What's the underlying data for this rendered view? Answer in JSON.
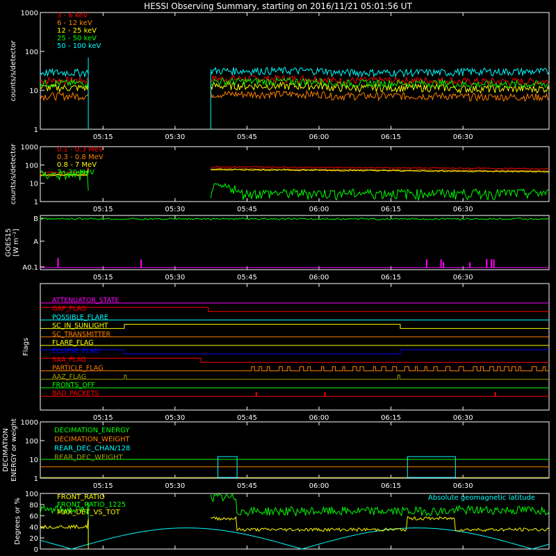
{
  "title": "HESSI Observing Summary, starting on 2016/11/21 05:01:56 UT",
  "time_ticks": [
    "05:15",
    "05:30",
    "05:45",
    "06:00",
    "06:15",
    "06:30"
  ],
  "colors": {
    "red": "#ff0000",
    "orange": "#ff8000",
    "yellow": "#ffff00",
    "green": "#00ff00",
    "cyan": "#00ffff",
    "magenta": "#ff00ff",
    "blue": "#0000ff",
    "olive": "#a0a000",
    "white": "#ffffff"
  },
  "chart_data": [
    {
      "id": "lightcurves-low",
      "type": "line",
      "ylabel": "counts/s/detector",
      "yscale": "log",
      "ylim": [
        1,
        1000
      ],
      "yticks": [
        "1",
        "10",
        "100",
        "1000"
      ],
      "series": [
        {
          "name": "3 - 6 keV",
          "color": "#ff0000",
          "level": 20
        },
        {
          "name": "6 - 12 keV",
          "color": "#ff8000",
          "level": 8
        },
        {
          "name": "12 - 25 keV",
          "color": "#ffff00",
          "level": 13
        },
        {
          "name": "25 - 50 keV",
          "color": "#00ff00",
          "level": 17
        },
        {
          "name": "50 - 100 keV",
          "color": "#00ffff",
          "level": 32
        }
      ]
    },
    {
      "id": "lightcurves-high",
      "type": "line",
      "ylabel": "counts/s/detector",
      "yscale": "log",
      "ylim": [
        1,
        1000
      ],
      "yticks": [
        "1",
        "10",
        "100",
        "1000"
      ],
      "series": [
        {
          "name": "0.1 - 0.3 MeV",
          "color": "#ff0000",
          "level": 80
        },
        {
          "name": "0.3 - 0.8 MeV",
          "color": "#ff8000",
          "level": 60
        },
        {
          "name": "0.8 - 7 MeV",
          "color": "#ffff00",
          "level": 55
        },
        {
          "name": "7 - 20 MeV",
          "color": "#00ff00",
          "level": 3
        }
      ]
    },
    {
      "id": "goes",
      "type": "line",
      "ylabel": "GOES15",
      "ylabel2": "[W m⁻²]",
      "yticks": [
        "A0.1",
        "A",
        "B"
      ]
    },
    {
      "id": "flags",
      "type": "line",
      "ylabel": "Flags",
      "flags": [
        {
          "name": "ATTENUATOR_STATE",
          "color": "#ff00ff"
        },
        {
          "name": "GAP_FLAG",
          "color": "#ff0000"
        },
        {
          "name": "POSSIBLE_FLARE",
          "color": "#00ffff"
        },
        {
          "name": "SC_IN_SUNLIGHT",
          "color": "#ffff00"
        },
        {
          "name": "SC_TRANSMITTER",
          "color": "#ff8000"
        },
        {
          "name": "FLARE_FLAG",
          "color": "#ffff00"
        },
        {
          "name": "ECLIPSE_FLAG",
          "color": "#0000ff"
        },
        {
          "name": "SAA_FLAG",
          "color": "#ff0000"
        },
        {
          "name": "PARTICLE_FLAG",
          "color": "#ff8000"
        },
        {
          "name": "AAZ_FLAG",
          "color": "#a0a000"
        },
        {
          "name": "FRONTS_OFF",
          "color": "#00ff00"
        },
        {
          "name": "BAD_PACKETS",
          "color": "#ff0000"
        }
      ]
    },
    {
      "id": "decimation",
      "type": "line",
      "ylabel": "DECIMATION",
      "ylabel2": "ENERGY or weight",
      "yscale": "log",
      "ylim": [
        1,
        1000
      ],
      "yticks": [
        "1",
        "10",
        "100",
        "1000"
      ],
      "series": [
        {
          "name": "DECIMATION_ENERGY",
          "color": "#00ff00"
        },
        {
          "name": "DECIMATION_WEIGHT",
          "color": "#ff8000"
        },
        {
          "name": "REAR_DEC_CHAN/128",
          "color": "#00ffff"
        },
        {
          "name": "REAR_DEC_WEIGHT",
          "color": "#a0a000"
        }
      ]
    },
    {
      "id": "ratios",
      "type": "line",
      "ylabel": "Degrees or %",
      "ylim": [
        0,
        100
      ],
      "yticks": [
        "0",
        "20",
        "40",
        "60",
        "80",
        "100"
      ],
      "series": [
        {
          "name": "FRONT_RATIO",
          "color": "#ffff00"
        },
        {
          "name": "FRONT_RATIO_1225",
          "color": "#00ff00"
        },
        {
          "name": "MAX_DET_VS_TOT",
          "color": "#ffff00"
        },
        {
          "name": "Absolute geomagnetic latitude",
          "color": "#00ffff"
        }
      ]
    }
  ]
}
